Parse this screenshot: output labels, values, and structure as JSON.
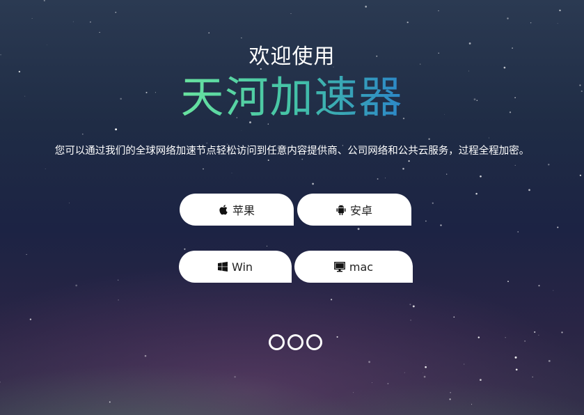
{
  "hero": {
    "welcome": "欢迎使用",
    "brand": "天河加速器",
    "description": "您可以通过我们的全球网络加速节点轻松访问到任意内容提供商、公司网络和公共云服务，过程全程加密。"
  },
  "downloads": [
    {
      "label": "苹果",
      "icon": "apple-icon"
    },
    {
      "label": "安卓",
      "icon": "android-icon"
    },
    {
      "label": "Win",
      "icon": "windows-icon"
    },
    {
      "label": "mac",
      "icon": "monitor-icon"
    }
  ],
  "loader": {
    "dot_count": 3
  },
  "colors": {
    "brand_gradient_start": "#69e3a0",
    "brand_gradient_end": "#2c86c8",
    "button_bg": "#ffffff",
    "text_light": "#ffffff"
  }
}
